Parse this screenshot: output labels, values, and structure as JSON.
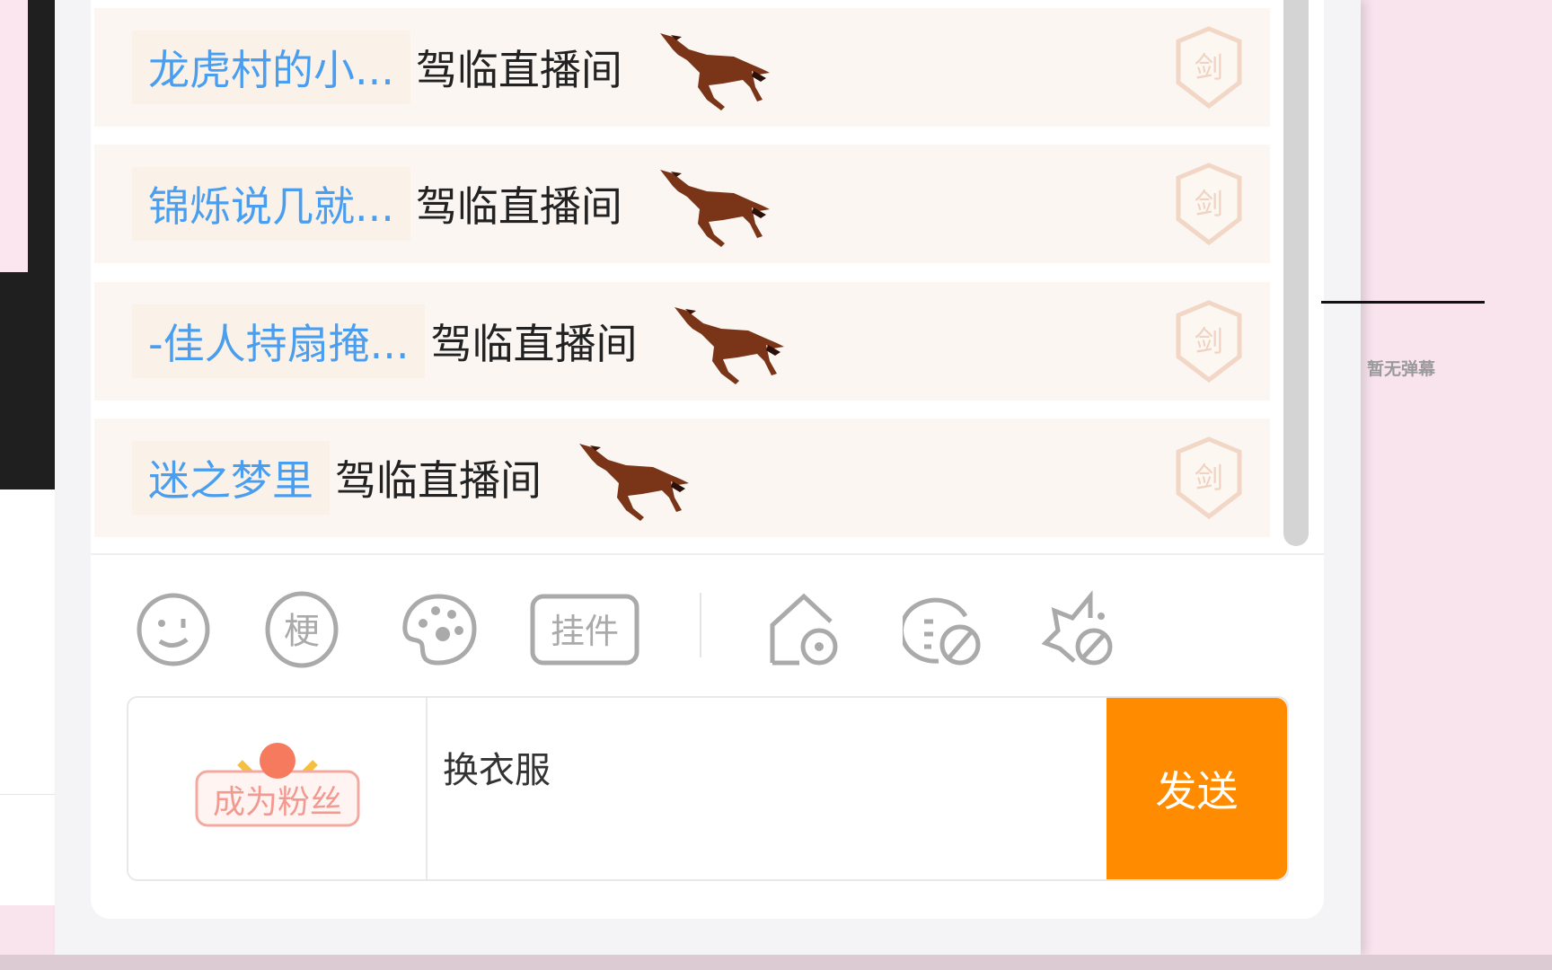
{
  "chat": {
    "entries": [
      {
        "user": "龙虎村的小...",
        "message": "驾临直播间",
        "badge": "剑"
      },
      {
        "user": "锦烁说几就...",
        "message": "驾临直播间",
        "badge": "剑"
      },
      {
        "user": "-佳人持扇掩...",
        "message": "驾临直播间",
        "badge": "剑"
      },
      {
        "user": "迷之梦里",
        "message": "驾临直播间",
        "badge": "剑"
      }
    ]
  },
  "toolbar": {
    "icons": [
      "emoji-icon",
      "meme-icon",
      "palette-icon",
      "pendant-icon",
      "home-block-icon",
      "chat-block-icon",
      "effect-block-icon"
    ],
    "meme_label": "梗",
    "pendant_label": "挂件"
  },
  "input": {
    "fan_label": "成为粉丝",
    "value": "换衣服",
    "send_label": "发送"
  },
  "side": {
    "empty_text": "暂无弹幕"
  },
  "colors": {
    "accent": "#ff8c00",
    "username": "#4a9eef",
    "row_bg": "#fbf6f2",
    "page_bg": "#f9e4ee"
  }
}
